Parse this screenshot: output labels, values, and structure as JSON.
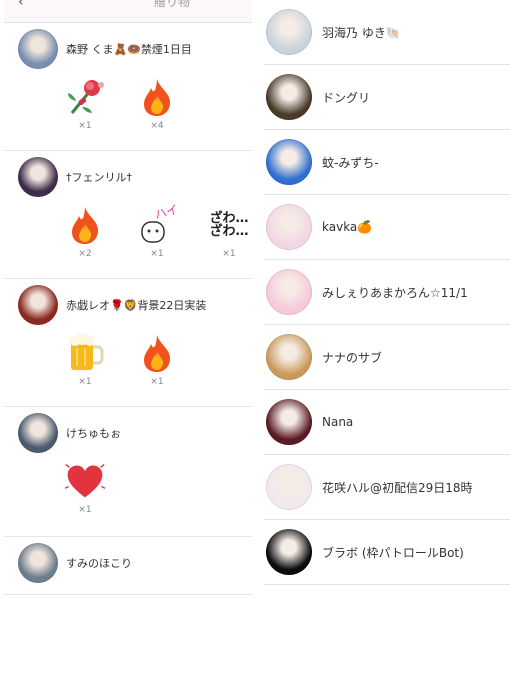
{
  "header": {
    "back_icon": "back-arrow-icon",
    "title": "贈り物"
  },
  "senders": [
    {
      "name": "森野 くま🧸🍩禁煙1日目",
      "avatar_color": "#7a8fb0",
      "gifts": [
        {
          "icon": "flower-bouquet-icon",
          "count": "×1"
        },
        {
          "icon": "fire-icon",
          "count": "×4"
        }
      ]
    },
    {
      "name": "†フェンリル†",
      "avatar_color": "#3e2c4a",
      "gifts": [
        {
          "icon": "fire-icon",
          "count": "×2"
        },
        {
          "icon": "hai-sticker-icon",
          "count": "×1",
          "text": "ハイ!"
        },
        {
          "icon": "zawa-sticker-icon",
          "count": "×1",
          "text": "ざわ…\nざわ…"
        }
      ]
    },
    {
      "name": "赤戯レオ🌹🦁背景22日実装",
      "avatar_color": "#8a2a20",
      "gifts": [
        {
          "icon": "beer-mug-icon",
          "count": "×1"
        },
        {
          "icon": "fire-icon",
          "count": "×1"
        }
      ]
    },
    {
      "name": "けちゅもぉ",
      "avatar_color": "#4a5c6e",
      "gifts": [
        {
          "icon": "heart-icon",
          "count": "×1"
        }
      ]
    },
    {
      "name": "すみのほこり",
      "avatar_color": "#6d7d8c",
      "gifts": []
    }
  ],
  "followers": [
    {
      "name": "羽海乃 ゆき🐚",
      "avatar_color": "#c9d3dc"
    },
    {
      "name": "ドングリ",
      "avatar_color": "#4a3a2a"
    },
    {
      "name": "蚊-みずち-",
      "avatar_color": "#2f6fd0"
    },
    {
      "name": "kavka🍊",
      "avatar_color": "#f3d6e4"
    },
    {
      "name": "みしぇりあまかろん☆11/1",
      "avatar_color": "#f7c9d9"
    },
    {
      "name": "ナナのサブ",
      "avatar_color": "#c99a5a"
    },
    {
      "name": "Nana",
      "avatar_color": "#5a1c24"
    },
    {
      "name": "花咲ハル@初配信29日18時",
      "avatar_color": "#f2e8ee"
    },
    {
      "name": "ブラボ (枠パトロールBot)",
      "avatar_color": "#0c0c0c"
    }
  ]
}
